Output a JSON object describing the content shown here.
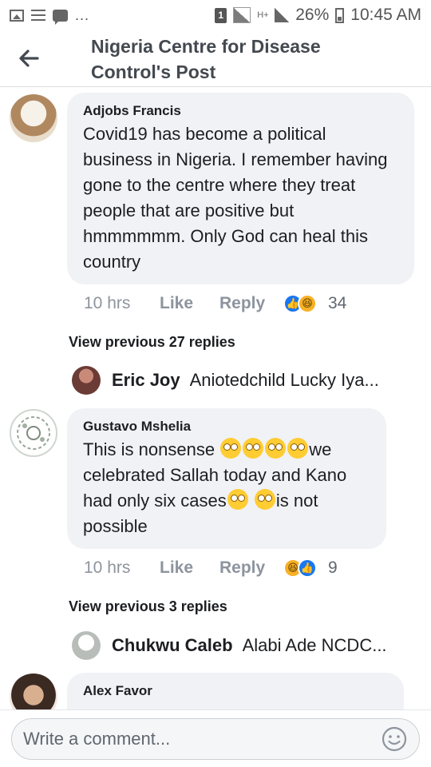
{
  "status_bar": {
    "left_dots": "...",
    "sim": "1",
    "network": "H+",
    "battery": "26%",
    "time": "10:45 AM"
  },
  "header": {
    "title": "Nigeria Centre for Disease Control's Post"
  },
  "comments": [
    {
      "author": "Adjobs Francis",
      "text": "Covid19 has become a political business in Nigeria. I remember having gone to the centre where they treat people that are positive but hmmmmmm. Only God can heal this country",
      "time": "10 hrs",
      "like_label": "Like",
      "reply_label": "Reply",
      "reactions": [
        "like",
        "haha"
      ],
      "reaction_count": "34",
      "view_previous": "View previous 27 replies",
      "reply_preview": {
        "name": "Eric Joy",
        "text": "Aniotedchild Lucky Iya..."
      }
    },
    {
      "author": "Gustavo Mshelia",
      "text_parts": [
        "This is nonsense ",
        "we celebrated Sallah today and Kano had only six cases",
        "is not possible"
      ],
      "time": "10 hrs",
      "like_label": "Like",
      "reply_label": "Reply",
      "reactions": [
        "haha",
        "like"
      ],
      "reaction_count": "9",
      "view_previous": "View previous 3 replies",
      "reply_preview": {
        "name": "Chukwu Caleb",
        "text": "Alabi Ade NCDC..."
      }
    },
    {
      "author": "Alex Favor",
      "text": ""
    }
  ],
  "composer": {
    "placeholder": "Write a comment..."
  }
}
